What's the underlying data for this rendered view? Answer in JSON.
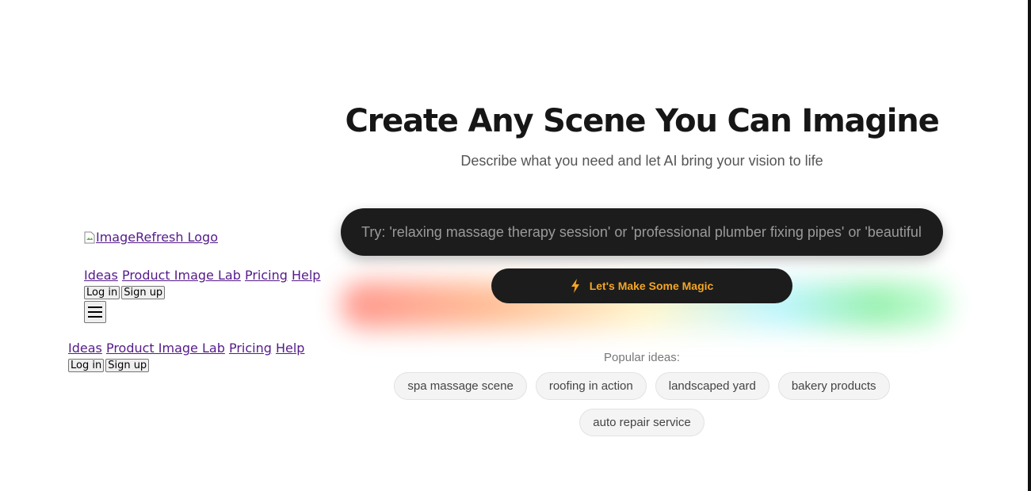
{
  "logo": {
    "alt": "ImageRefresh Logo"
  },
  "nav_top": {
    "links": [
      "Ideas",
      "Product Image Lab",
      "Pricing",
      "Help"
    ],
    "login": "Log in",
    "signup": "Sign up"
  },
  "nav_mobile": {
    "links": [
      "Ideas",
      "Product Image Lab",
      "Pricing",
      "Help"
    ],
    "login": "Log in",
    "signup": "Sign up"
  },
  "hero": {
    "title": "Create Any Scene You Can Imagine",
    "subtitle": "Describe what you need and let AI bring your vision to life"
  },
  "prompt": {
    "placeholder": "Try: 'relaxing massage therapy session' or 'professional plumber fixing pipes' or 'beautiful",
    "value": ""
  },
  "cta": {
    "label": "Let's Make Some Magic",
    "icon": "lightning-icon",
    "color": "#f5a623"
  },
  "ideas": {
    "label": "Popular ideas:",
    "chips": [
      "spa massage scene",
      "roofing in action",
      "landscaped yard",
      "bakery products",
      "auto repair service"
    ]
  }
}
